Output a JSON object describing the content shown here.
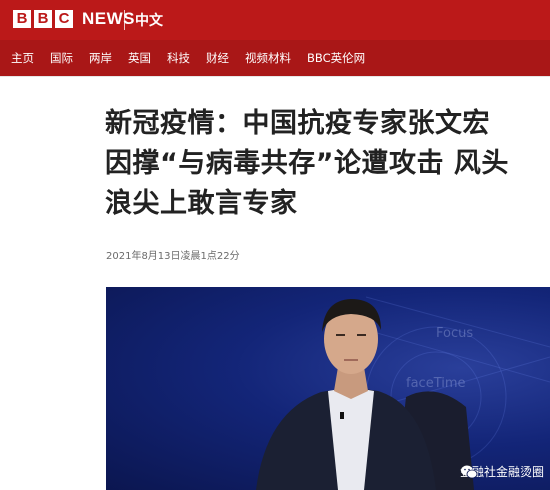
{
  "header": {
    "logo_letters": [
      "B",
      "B",
      "C"
    ],
    "brand": "NEWS",
    "language": "中文",
    "colors": {
      "brand_red": "#bb1919",
      "nav_red": "#a91717"
    }
  },
  "nav": {
    "items": [
      "主页",
      "国际",
      "两岸",
      "英国",
      "科技",
      "财经",
      "视频材料",
      "BBC英伦网"
    ]
  },
  "article": {
    "headline_lines": [
      "新冠疫情：中国抗疫专家张文宏",
      "因撑“与病毒共存”论遭攻击 风头",
      "浪尖上敢言专家"
    ],
    "timestamp": "2021年8月13日凌晨1点22分",
    "image": {
      "watermark_lines": [
        "Focus",
        "faceTime"
      ],
      "icon": "wechat-icon",
      "channel_label": "金融社金融烫圈"
    }
  }
}
